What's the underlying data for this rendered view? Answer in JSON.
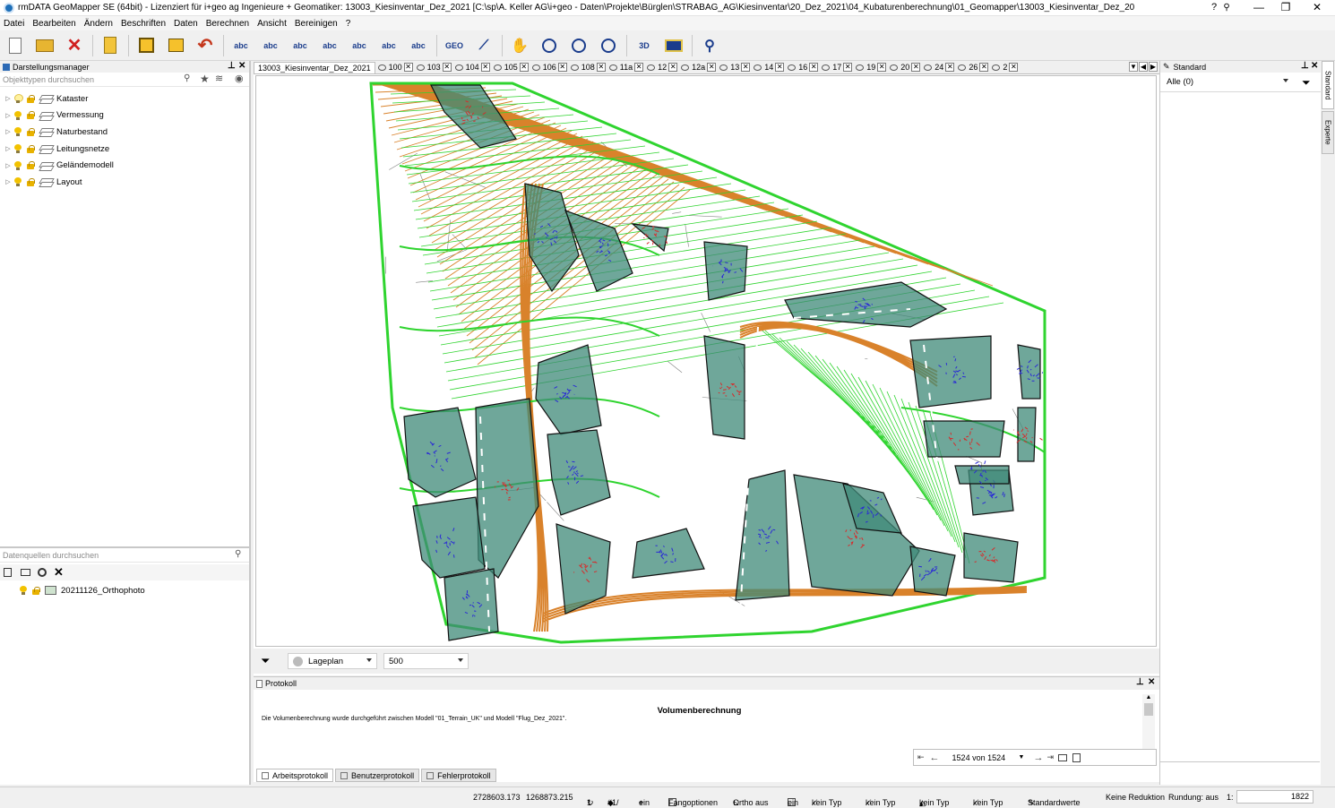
{
  "window": {
    "title": "rmDATA GeoMapper SE (64bit) - Lizenziert für i+geo ag Ingenieure + Geomatiker: 13003_Kiesinventar_Dez_2021 [C:\\sp\\A. Keller AG\\i+geo - Daten\\Projekte\\Bürglen\\STRABAG_AG\\Kiesinventar\\20_Dez_2021\\04_Kubaturenberechnung\\01_Geomapper\\13003_Kiesinventar_Dez_20",
    "minimize": "—",
    "restore": "❐",
    "close": "✕"
  },
  "menu": [
    "Datei",
    "Bearbeiten",
    "Ändern",
    "Beschriften",
    "Daten",
    "Berechnen",
    "Ansicht",
    "Bereinigen",
    "?"
  ],
  "toolbar": {
    "icons": [
      "new-file-icon",
      "open-folder-icon",
      "close-red-x-icon",
      "project-book-icon",
      "save-icon",
      "export-icon",
      "undo-icon",
      "label-abc-1-icon",
      "label-abc-2-icon",
      "label-abc-3-icon",
      "label-abc-4-icon",
      "label-abc-5-icon",
      "label-abc-6-icon",
      "label-abc-7-icon",
      "geo-icon",
      "measure-icon",
      "pan-hand-icon",
      "zoom-icon",
      "zoom-out-icon",
      "zoom-in-icon",
      "3d-icon",
      "map-view-icon",
      "wrench-icon"
    ],
    "texts": {
      "label-abc-1-icon": "abc",
      "label-abc-2-icon": "abc",
      "label-abc-3-icon": "abc",
      "label-abc-4-icon": "abc",
      "label-abc-5-icon": "abc",
      "label-abc-6-icon": "abc",
      "label-abc-7-icon": "abc",
      "geo-icon": "GEO",
      "3d-icon": "3D"
    }
  },
  "darstellungsmanager": {
    "title": "Darstellungsmanager",
    "search_placeholder": "Objekttypen durchsuchen",
    "layers": [
      {
        "name": "Kataster",
        "bulb_on": false
      },
      {
        "name": "Vermessung",
        "bulb_on": true
      },
      {
        "name": "Naturbestand",
        "bulb_on": true
      },
      {
        "name": "Leitungsnetze",
        "bulb_on": true
      },
      {
        "name": "Geländemodell",
        "bulb_on": true
      },
      {
        "name": "Layout",
        "bulb_on": true
      }
    ]
  },
  "datenquellen": {
    "search_placeholder": "Datenquellen durchsuchen",
    "items": [
      {
        "name": "20211126_Orthophoto"
      }
    ]
  },
  "document_tabs": {
    "active": "13003_Kiesinventar_Dez_2021",
    "tabs": [
      "100",
      "103",
      "104",
      "105",
      "106",
      "108",
      "11a",
      "12",
      "12a",
      "13",
      "14",
      "16",
      "17",
      "19",
      "20",
      "24",
      "26",
      "2"
    ]
  },
  "mapbar": {
    "view": "Lageplan",
    "scale": "500"
  },
  "protokoll": {
    "title": "Protokoll",
    "heading": "Volumenberechnung",
    "text": "Die Volumenberechnung wurde durchgeführt zwischen Modell \"01_Terrain_UK\" und Modell \"Flug_Dez_2021\".",
    "pager": "1524 von 1524",
    "tabs": [
      "Arbeitsprotokoll",
      "Benutzerprotokoll",
      "Fehlerprotokoll"
    ]
  },
  "rightpanel": {
    "title": "Standard",
    "filter_value": "Alle (0)",
    "vtabs": [
      "Standard",
      "Experte"
    ]
  },
  "statusbar": {
    "x": "2728603.173",
    "y": "1268873.215",
    "count": "1",
    "snap": "#1/",
    "ein1": "ein",
    "fangoptionen": "Fangoptionen",
    "ortho": "Ortho aus",
    "ein2": "ein",
    "typ1": "kein Typ",
    "typ2": "kein Typ",
    "typ3": "kein Typ",
    "typ4": "kein Typ",
    "standardwerte": "Standardwerte",
    "reduktion": "Keine Reduktion",
    "rundung": "Rundung: aus",
    "scale_prefix": "1:",
    "scale": "1822"
  },
  "colors": {
    "mesh": "#7f7f7f",
    "contour_green": "#2fd42f",
    "contour_orange": "#d9822b",
    "polygon_fill": "#3f8a78",
    "blue": "#2a2ad6",
    "red": "#d82a2a"
  }
}
